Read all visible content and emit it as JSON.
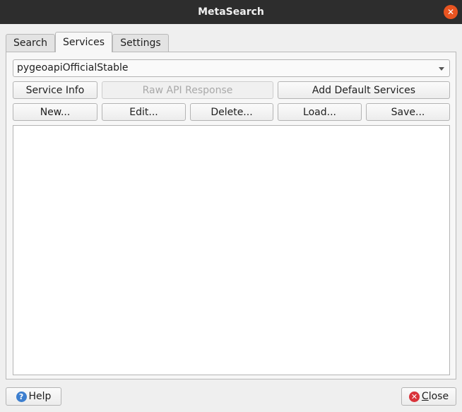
{
  "window": {
    "title": "MetaSearch"
  },
  "tabs": [
    {
      "label": "Search"
    },
    {
      "label": "Services"
    },
    {
      "label": "Settings"
    }
  ],
  "services": {
    "selected": "pygeoapiOfficialStable",
    "buttons": {
      "service_info": "Service Info",
      "raw_api_response": "Raw API Response",
      "add_default": "Add Default Services",
      "new": "New...",
      "edit": "Edit...",
      "delete": "Delete...",
      "load": "Load...",
      "save": "Save..."
    }
  },
  "footer": {
    "help": "Help",
    "close_first": "C",
    "close_rest": "lose"
  },
  "icons": {
    "close_window": "close-icon",
    "help": "help-icon",
    "close": "close-icon"
  },
  "colors": {
    "titlebar": "#2d2d2d",
    "close_accent": "#e95420",
    "help_icon": "#3d7fcf",
    "close_icon": "#d9333a"
  }
}
